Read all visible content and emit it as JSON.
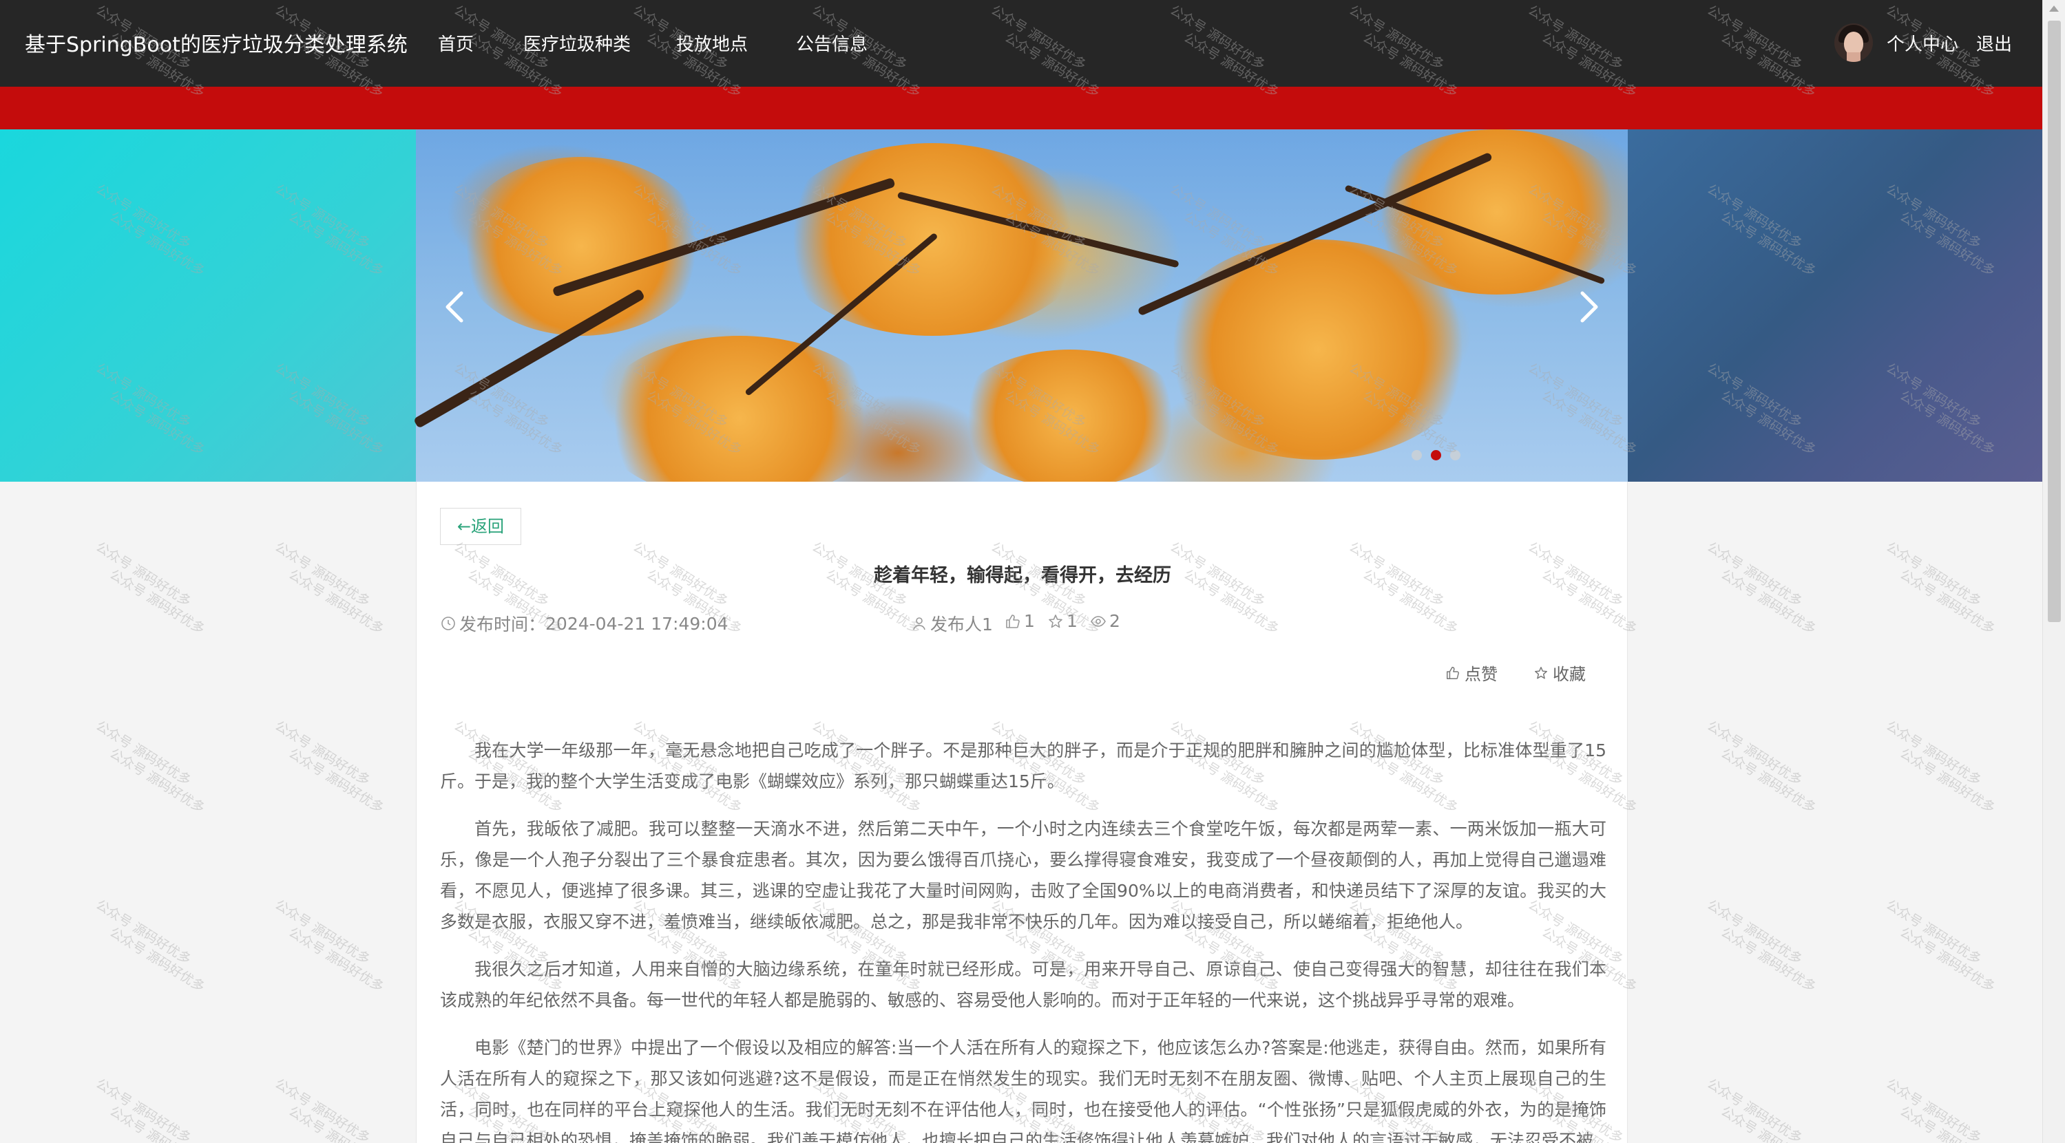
{
  "header": {
    "brand": "基于SpringBoot的医疗垃圾分类处理系统",
    "nav": [
      {
        "label": "首页"
      },
      {
        "label": "医疗垃圾种类"
      },
      {
        "label": "投放地点"
      },
      {
        "label": "公告信息"
      }
    ],
    "personal_center": "个人中心",
    "logout": "退出"
  },
  "carousel": {
    "slide_count": 3,
    "active_index": 1
  },
  "post": {
    "back_label": "←返回",
    "title": "趁着年轻，输得起，看得开，去经历",
    "publish_label": "发布时间：",
    "publish_time": "2024-04-21 17:49:04",
    "author": "发布人1",
    "likes": "1",
    "favorites": "1",
    "views": "2",
    "like_action": "点赞",
    "favorite_action": "收藏",
    "paragraphs": [
      "我在大学一年级那一年，毫无悬念地把自己吃成了一个胖子。不是那种巨大的胖子，而是介于正规的肥胖和臃肿之间的尴尬体型，比标准体型重了15斤。于是，我的整个大学生活变成了电影《蝴蝶效应》系列，那只蝴蝶重达15斤。",
      "首先，我皈依了减肥。我可以整整一天滴水不进，然后第二天中午，一个小时之内连续去三个食堂吃午饭，每次都是两荤一素、一两米饭加一瓶大可乐，像是一个人孢子分裂出了三个暴食症患者。其次，因为要么饿得百爪挠心，要么撑得寝食难安，我变成了一个昼夜颠倒的人，再加上觉得自己邋遢难看，不愿见人，便逃掉了很多课。其三，逃课的空虚让我花了大量时间网购，击败了全国90%以上的电商消费者，和快递员结下了深厚的友谊。我买的大多数是衣服，衣服又穿不进，羞愤难当，继续皈依减肥。总之，那是我非常不快乐的几年。因为难以接受自己，所以蜷缩着，拒绝他人。",
      "我很久之后才知道，人用来自憎的大脑边缘系统，在童年时就已经形成。可是，用来开导自己、原谅自己、使自己变得强大的智慧，却往往在我们本该成熟的年纪依然不具备。每一世代的年轻人都是脆弱的、敏感的、容易受他人影响的。而对于正年轻的一代来说，这个挑战异乎寻常的艰难。",
      "电影《楚门的世界》中提出了一个假设以及相应的解答:当一个人活在所有人的窥探之下，他应该怎么办?答案是:他逃走，获得自由。然而，如果所有人活在所有人的窥探之下，那又该如何逃避?这不是假设，而是正在悄然发生的现实。我们无时无刻不在朋友圈、微博、贴吧、个人主页上展现自己的生活，同时，也在同样的平台上窥探他人的生活。我们无时无刻不在评估他人，同时，也在接受他人的评估。“个性张扬”只是狐假虎威的外衣，为的是掩饰自己与自己相处的恐惧，掩盖掩饰的脆弱。我们善于模仿他人，也擅长把自己的生活修饰得让他人羡慕嫉妒，我们对他人的言语过于敏感，无法忍受不被"
    ]
  },
  "watermark": {
    "text": "公众号 源码好优多"
  },
  "colors": {
    "topbar": "#262626",
    "accent_red": "#c40c0c",
    "back_link": "#2aa37a"
  }
}
